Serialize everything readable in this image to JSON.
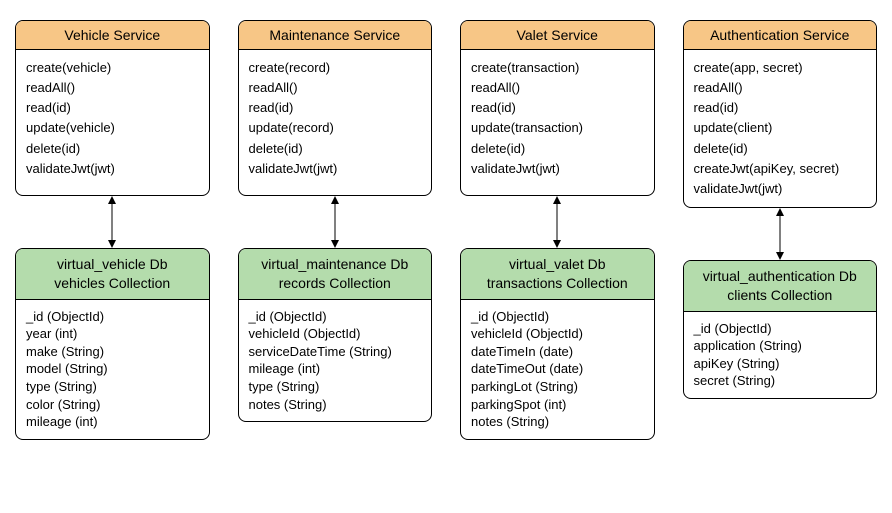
{
  "columns": [
    {
      "service": {
        "title": "Vehicle Service",
        "methods": [
          "create(vehicle)",
          "readAll()",
          "read(id)",
          "update(vehicle)",
          "delete(id)",
          "validateJwt(jwt)"
        ]
      },
      "db": {
        "title_line1": "virtual_vehicle Db",
        "title_line2": "vehicles Collection",
        "fields": [
          "_id (ObjectId)",
          "year (int)",
          "make (String)",
          "model (String)",
          "type (String)",
          "color (String)",
          "mileage (int)"
        ]
      }
    },
    {
      "service": {
        "title": "Maintenance Service",
        "methods": [
          "create(record)",
          "readAll()",
          "read(id)",
          "update(record)",
          "delete(id)",
          "validateJwt(jwt)"
        ]
      },
      "db": {
        "title_line1": "virtual_maintenance Db",
        "title_line2": "records Collection",
        "fields": [
          "_id (ObjectId)",
          "vehicleId (ObjectId)",
          "serviceDateTime (String)",
          "mileage (int)",
          "type (String)",
          "notes (String)"
        ]
      }
    },
    {
      "service": {
        "title": "Valet Service",
        "methods": [
          "create(transaction)",
          "readAll()",
          "read(id)",
          "update(transaction)",
          "delete(id)",
          "validateJwt(jwt)"
        ]
      },
      "db": {
        "title_line1": "virtual_valet Db",
        "title_line2": "transactions Collection",
        "fields": [
          "_id (ObjectId)",
          "vehicleId (ObjectId)",
          "dateTimeIn (date)",
          "dateTimeOut (date)",
          "parkingLot (String)",
          "parkingSpot (int)",
          "notes (String)"
        ]
      }
    },
    {
      "service": {
        "title": "Authentication Service",
        "methods": [
          "create(app, secret)",
          "readAll()",
          "read(id)",
          "update(client)",
          "delete(id)",
          "createJwt(apiKey, secret)",
          "validateJwt(jwt)"
        ]
      },
      "db": {
        "title_line1": "virtual_authentication Db",
        "title_line2": "clients Collection",
        "fields": [
          "_id (ObjectId)",
          "application (String)",
          "apiKey (String)",
          "secret (String)"
        ]
      }
    }
  ]
}
